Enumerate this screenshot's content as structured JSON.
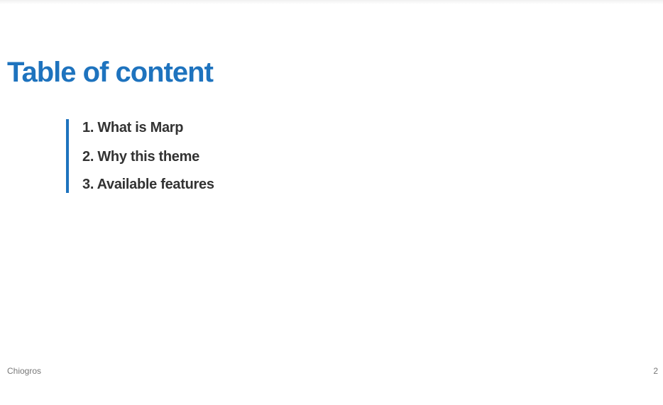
{
  "slide": {
    "title": "Table of content",
    "toc": [
      {
        "label": "1. What is Marp"
      },
      {
        "label": "2. Why this theme"
      },
      {
        "label": "3. Available features"
      }
    ],
    "footer": {
      "author": "Chiogros",
      "page_number": "2"
    }
  },
  "colors": {
    "accent": "#1e73be",
    "text": "#333333",
    "footer_text": "#777777",
    "background": "#ffffff"
  }
}
